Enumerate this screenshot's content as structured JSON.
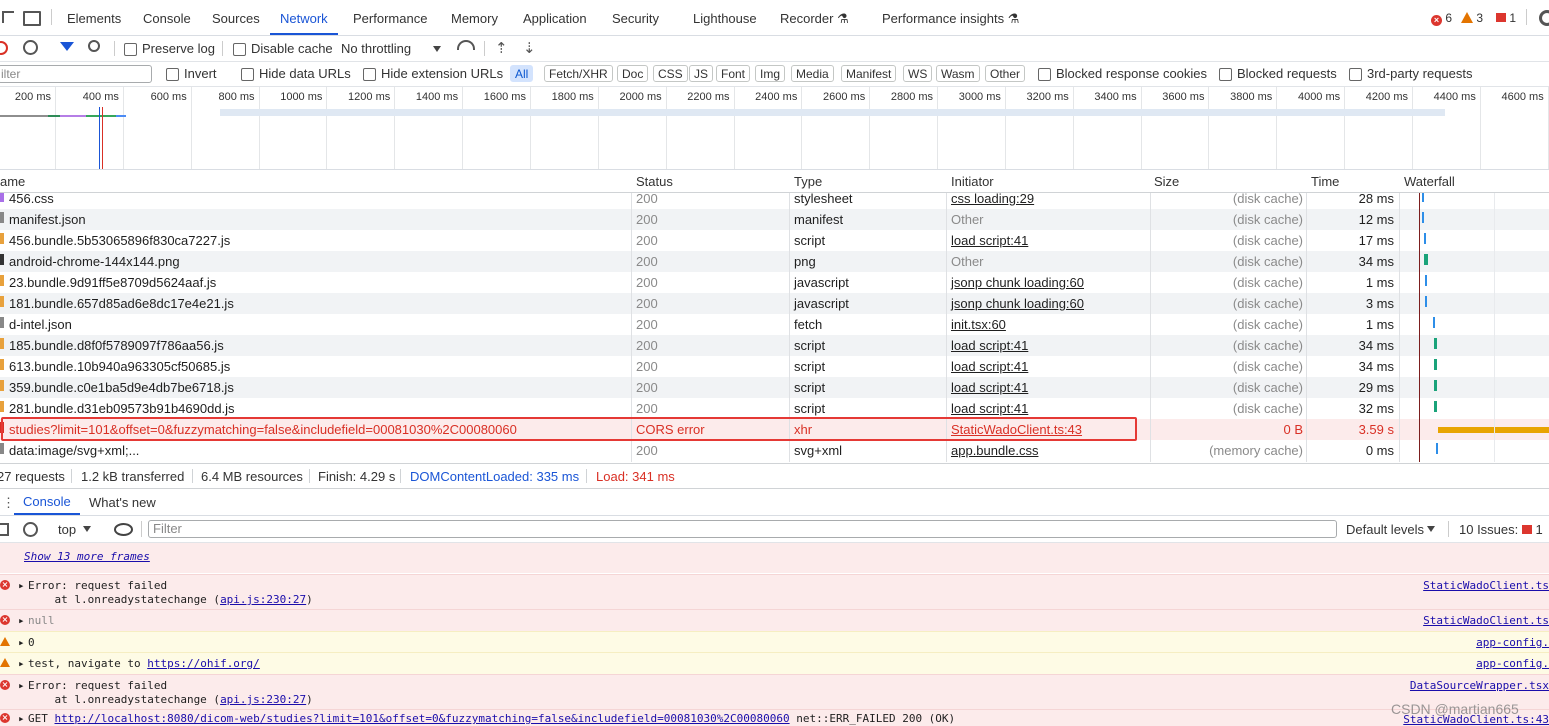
{
  "tabs": [
    "Elements",
    "Console",
    "Sources",
    "Network",
    "Performance",
    "Memory",
    "Application",
    "Security",
    "Lighthouse",
    "Recorder",
    "Performance insights"
  ],
  "active_tab": "Network",
  "counters": {
    "errors": "6",
    "warnings": "3",
    "issues": "1"
  },
  "toolbar": {
    "preserve_log": "Preserve log",
    "disable_cache": "Disable cache",
    "throttling": "No throttling"
  },
  "filterbar": {
    "placeholder": "ilter",
    "invert": "Invert",
    "hide_data_urls": "Hide data URLs",
    "hide_extension_urls": "Hide extension URLs",
    "types": [
      "All",
      "Fetch/XHR",
      "Doc",
      "CSS",
      "JS",
      "Font",
      "Img",
      "Media",
      "Manifest",
      "WS",
      "Wasm",
      "Other"
    ],
    "blocked_cookies": "Blocked response cookies",
    "blocked_requests": "Blocked requests",
    "third_party": "3rd-party requests"
  },
  "timeline": {
    "ticks": [
      "200 ms",
      "400 ms",
      "600 ms",
      "800 ms",
      "1000 ms",
      "1200 ms",
      "1400 ms",
      "1600 ms",
      "1800 ms",
      "2000 ms",
      "2200 ms",
      "2400 ms",
      "2600 ms",
      "2800 ms",
      "3000 ms",
      "3200 ms",
      "3400 ms",
      "3600 ms",
      "3800 ms",
      "4000 ms",
      "4200 ms",
      "4400 ms",
      "4600 ms"
    ]
  },
  "columns": {
    "name": "ame",
    "status": "Status",
    "type": "Type",
    "initiator": "Initiator",
    "size": "Size",
    "time": "Time",
    "waterfall": "Waterfall"
  },
  "rows": [
    {
      "name": "456.css",
      "status": "200",
      "type": "stylesheet",
      "initiator": "css loading:29",
      "size": "(disk cache)",
      "time": "28 ms"
    },
    {
      "name": "manifest.json",
      "status": "200",
      "type": "manifest",
      "initiator": "Other",
      "size": "(disk cache)",
      "time": "12 ms"
    },
    {
      "name": "456.bundle.5b53065896f830ca7227.js",
      "status": "200",
      "type": "script",
      "initiator": "load script:41",
      "size": "(disk cache)",
      "time": "17 ms"
    },
    {
      "name": "android-chrome-144x144.png",
      "status": "200",
      "type": "png",
      "initiator": "Other",
      "size": "(disk cache)",
      "time": "34 ms"
    },
    {
      "name": "23.bundle.9d91ff5e8709d5624aaf.js",
      "status": "200",
      "type": "javascript",
      "initiator": "jsonp chunk loading:60",
      "size": "(disk cache)",
      "time": "1 ms"
    },
    {
      "name": "181.bundle.657d85ad6e8dc17e4e21.js",
      "status": "200",
      "type": "javascript",
      "initiator": "jsonp chunk loading:60",
      "size": "(disk cache)",
      "time": "3 ms"
    },
    {
      "name": "d-intel.json",
      "status": "200",
      "type": "fetch",
      "initiator": "init.tsx:60",
      "size": "(disk cache)",
      "time": "1 ms"
    },
    {
      "name": "185.bundle.d8f0f5789097f786aa56.js",
      "status": "200",
      "type": "script",
      "initiator": "load script:41",
      "size": "(disk cache)",
      "time": "34 ms"
    },
    {
      "name": "613.bundle.10b940a963305cf50685.js",
      "status": "200",
      "type": "script",
      "initiator": "load script:41",
      "size": "(disk cache)",
      "time": "34 ms"
    },
    {
      "name": "359.bundle.c0e1ba5d9e4db7be6718.js",
      "status": "200",
      "type": "script",
      "initiator": "load script:41",
      "size": "(disk cache)",
      "time": "29 ms"
    },
    {
      "name": "281.bundle.d31eb09573b91b4690dd.js",
      "status": "200",
      "type": "script",
      "initiator": "load script:41",
      "size": "(disk cache)",
      "time": "32 ms"
    },
    {
      "name": "studies?limit=101&offset=0&fuzzymatching=false&includefield=00081030%2C00080060",
      "status": "CORS error",
      "type": "xhr",
      "initiator": "StaticWadoClient.ts:43",
      "size": "0 B",
      "time": "3.59 s"
    },
    {
      "name": "data:image/svg+xml;...",
      "status": "200",
      "type": "svg+xml",
      "initiator": "app.bundle.css",
      "size": "(memory cache)",
      "time": "0 ms"
    }
  ],
  "summary": {
    "requests": "27 requests",
    "transferred": "1.2 kB transferred",
    "resources": "6.4 MB resources",
    "finish": "Finish: 4.29 s",
    "dcl": "DOMContentLoaded: 335 ms",
    "load": "Load: 341 ms"
  },
  "drawer": {
    "tabs": [
      "Console",
      "What's new"
    ]
  },
  "console_toolbar": {
    "context": "top",
    "filter_placeholder": "Filter",
    "levels": "Default levels",
    "issues": "10 Issues:",
    "issues_count": "1"
  },
  "console": {
    "show_more": "Show 13 more frames",
    "messages": [
      {
        "level": "error",
        "line1": "Error: request failed",
        "line2a": "    at l.onreadystatechange (",
        "link": "api.js:230:27",
        "line2b": ")",
        "source": "StaticWadoClient.ts"
      },
      {
        "level": "error",
        "line1": "null",
        "source": "StaticWadoClient.ts"
      },
      {
        "level": "warn",
        "line1": "0",
        "source": "app-config."
      },
      {
        "level": "warn",
        "line1": "test, navigate to ",
        "url": "https://ohif.org/",
        "source": "app-config."
      },
      {
        "level": "error",
        "line1": "Error: request failed",
        "line2a": "    at l.onreadystatechange (",
        "link": "api.js:230:27",
        "line2b": ")",
        "source": "DataSourceWrapper.tsx"
      },
      {
        "level": "error",
        "line1": "GET ",
        "url": "http://localhost:8080/dicom-web/studies?limit=101&offset=0&fuzzymatching=false&includefield=00081030%2C00080060",
        "tail": " net::ERR_FAILED 200 (OK)",
        "source": "StaticWadoClient.ts:43"
      }
    ]
  },
  "watermark": "CSDN @martian665",
  "colors": {
    "accent": "#1a55d6",
    "error": "#d93025",
    "warning": "#e37400",
    "highlight_box": "#e53935"
  }
}
